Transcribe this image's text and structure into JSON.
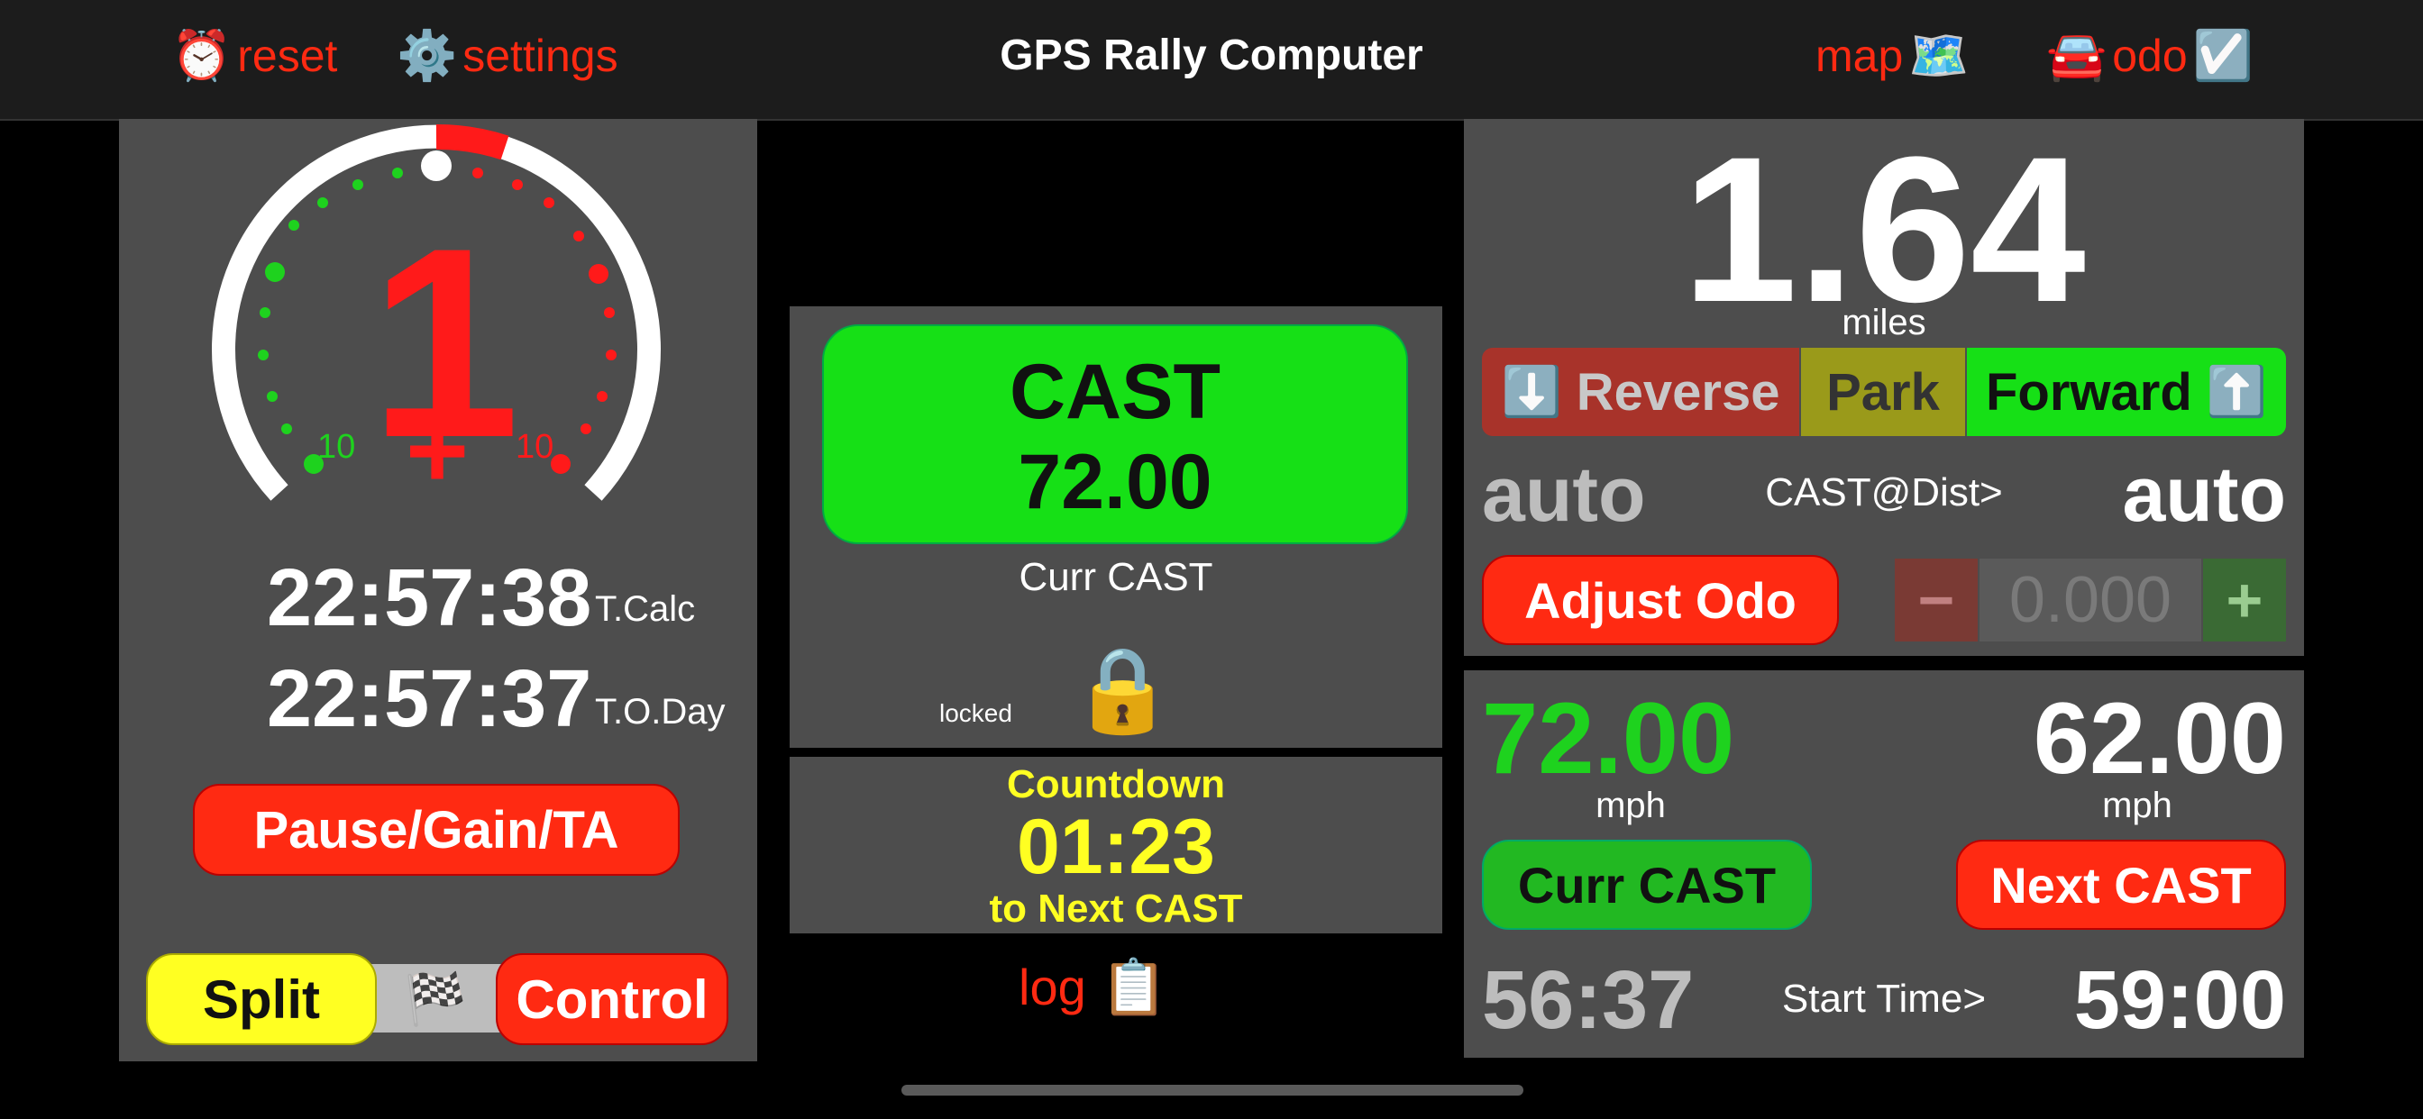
{
  "topbar": {
    "reset_icon": "⏰",
    "reset_label": "reset",
    "settings_icon": "⚙️",
    "settings_label": "settings",
    "title": "GPS Rally Computer",
    "map_label": "map",
    "map_icon": "🗺️",
    "odo_icon": "🚘",
    "odo_label": "odo",
    "odo_check_icon": "☑️"
  },
  "left": {
    "gauge_digit": "1",
    "gauge_sign": "+",
    "gauge_left_label": "10",
    "gauge_right_label": "10",
    "tcalc_time": "22:57:38",
    "tcalc_label": "T.Calc",
    "today_time": "22:57:37",
    "today_label": "T.O.Day",
    "pause_button": "Pause/Gain/TA",
    "split_button": "Split",
    "flag_icon": "🏁",
    "control_button": "Control"
  },
  "middle": {
    "cast_title": "CAST",
    "cast_value": "72.00",
    "curr_cast_label": "Curr CAST",
    "locked_label": "locked",
    "lock_icon": "🔒",
    "countdown_title": "Countdown",
    "countdown_value": "01:23",
    "countdown_sub": "to Next CAST",
    "log_label": "log",
    "log_icon": "📋"
  },
  "right_top": {
    "distance": "1.64",
    "distance_unit": "miles",
    "reverse_icon": "⬇️",
    "reverse_label": "Reverse",
    "park_label": "Park",
    "forward_label": "Forward",
    "forward_icon": "⬆️",
    "auto_left": "auto",
    "cast_at_dist": "CAST@Dist>",
    "auto_right": "auto",
    "adjust_odo_button": "Adjust Odo",
    "minus_label": "−",
    "odo_adjust_value": "0.000",
    "plus_label": "+"
  },
  "right_bottom": {
    "curr_speed": "72.00",
    "curr_speed_unit": "mph",
    "next_speed": "62.00",
    "next_speed_unit": "mph",
    "curr_cast_button": "Curr CAST",
    "next_cast_button": "Next CAST",
    "elapsed": "56:37",
    "start_time_label": "Start Time>",
    "start_time": "59:00"
  },
  "colors": {
    "accent_red": "#ff2a12",
    "accent_green": "#16e016",
    "countdown_yellow": "#ffff22",
    "panel_gray": "#4d4d4d"
  }
}
